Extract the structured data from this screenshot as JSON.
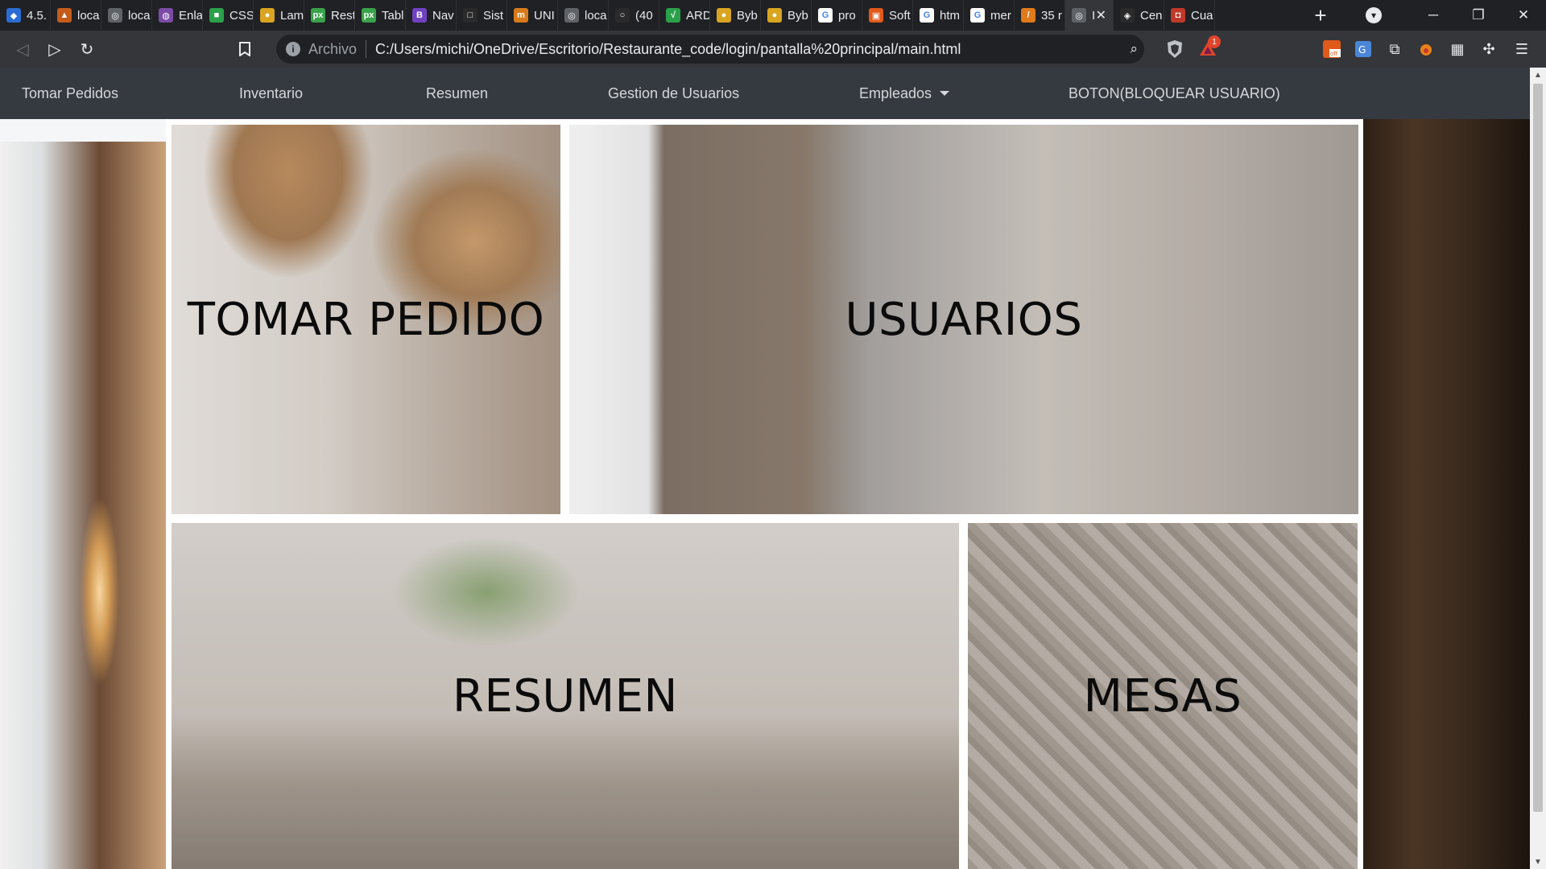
{
  "browser": {
    "tabs": [
      {
        "label": "4.5.",
        "fav_color": "#2b6cd4",
        "fav_glyph": "◆"
      },
      {
        "label": "loca",
        "fav_color": "#c45c1b",
        "fav_glyph": "▲"
      },
      {
        "label": "loca",
        "fav_color": "#5f6368",
        "fav_glyph": "◎"
      },
      {
        "label": "Enla",
        "fav_color": "#7b4aa6",
        "fav_glyph": "◍"
      },
      {
        "label": "CSS",
        "fav_color": "#2aa04a",
        "fav_glyph": "■"
      },
      {
        "label": "Lam",
        "fav_color": "#d9a520",
        "fav_glyph": "●"
      },
      {
        "label": "Rest",
        "fav_color": "#3aa24a",
        "fav_glyph": "px"
      },
      {
        "label": "Tabl",
        "fav_color": "#3aa24a",
        "fav_glyph": "px"
      },
      {
        "label": "Nav",
        "fav_color": "#6f42c1",
        "fav_glyph": "B"
      },
      {
        "label": "Sist",
        "fav_color": "#2a2a2a",
        "fav_glyph": "□"
      },
      {
        "label": "UNI",
        "fav_color": "#d97b1b",
        "fav_glyph": "m"
      },
      {
        "label": "loca",
        "fav_color": "#5f6368",
        "fav_glyph": "◎"
      },
      {
        "label": "(40",
        "fav_color": "#2a2a2a",
        "fav_glyph": "○"
      },
      {
        "label": "ARD",
        "fav_color": "#2aa04a",
        "fav_glyph": "√"
      },
      {
        "label": "Byb",
        "fav_color": "#d9a520",
        "fav_glyph": "●"
      },
      {
        "label": "Byb",
        "fav_color": "#d9a520",
        "fav_glyph": "●"
      },
      {
        "label": "pro",
        "fav_color": "#ffffff",
        "fav_glyph": "G"
      },
      {
        "label": "Soft",
        "fav_color": "#e05a1a",
        "fav_glyph": "▣"
      },
      {
        "label": "htm",
        "fav_color": "#ffffff",
        "fav_glyph": "G"
      },
      {
        "label": "mer",
        "fav_color": "#ffffff",
        "fav_glyph": "G"
      },
      {
        "label": "35 r",
        "fav_color": "#e07a1a",
        "fav_glyph": "/"
      },
      {
        "label": "I",
        "fav_color": "#5f6368",
        "fav_glyph": "◎",
        "active": true
      },
      {
        "label": "Cen",
        "fav_color": "#2a2a2a",
        "fav_glyph": "◈"
      },
      {
        "label": "Cua",
        "fav_color": "#c0392b",
        "fav_glyph": "◘"
      }
    ],
    "new_tab": "+",
    "address": {
      "scheme": "Archivo",
      "url": "C:/Users/michi/OneDrive/Escritorio/Restaurante_code/login/pantalla%20principal/main.html"
    },
    "bat_badge": "1"
  },
  "nav": {
    "items": [
      {
        "label": "Tomar Pedidos"
      },
      {
        "label": "Inventario"
      },
      {
        "label": "Resumen"
      },
      {
        "label": "Gestion de Usuarios"
      },
      {
        "label": "Empleados"
      },
      {
        "label": "BOTON(BLOQUEAR USUARIO)"
      }
    ]
  },
  "tiles": {
    "tomar_pedido": "TOMAR PEDIDO",
    "usuarios": "USUARIOS",
    "resumen": "RESUMEN",
    "mesas": "MESAS"
  }
}
